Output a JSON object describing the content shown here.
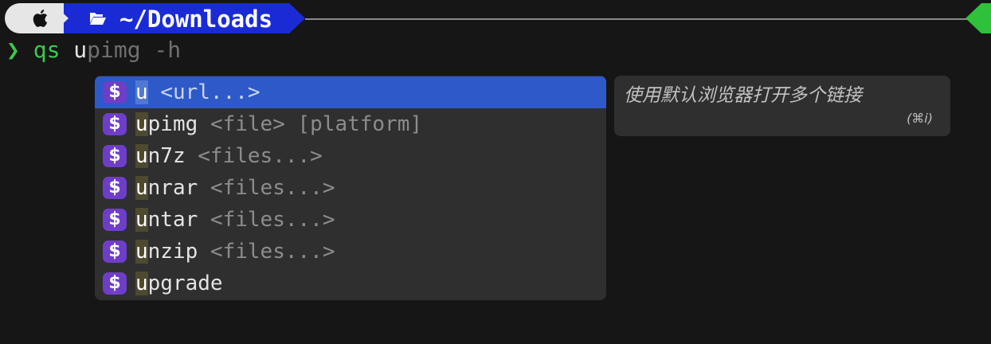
{
  "prompt": {
    "directory": "~/Downloads",
    "apple_icon": "apple-logo-icon",
    "folder_icon": "folder-open-icon",
    "colors": {
      "apple_segment": "#e6e6e6",
      "dir_segment": "#1a2bd6",
      "right_cap": "#2fc03c"
    }
  },
  "command": {
    "chevron": "❯",
    "name": "qs",
    "typed": "u",
    "suggestion": "pimg -h"
  },
  "completions": {
    "items": [
      {
        "match": "u",
        "rest": "",
        "args": "<url...>",
        "selected": true
      },
      {
        "match": "u",
        "rest": "pimg",
        "args": "<file> [platform]",
        "selected": false
      },
      {
        "match": "u",
        "rest": "n7z",
        "args": "<files...>",
        "selected": false
      },
      {
        "match": "u",
        "rest": "nrar",
        "args": "<files...>",
        "selected": false
      },
      {
        "match": "u",
        "rest": "ntar",
        "args": "<files...>",
        "selected": false
      },
      {
        "match": "u",
        "rest": "nzip",
        "args": "<files...>",
        "selected": false
      },
      {
        "match": "u",
        "rest": "pgrade",
        "args": "",
        "selected": false
      }
    ],
    "item_icon": "$",
    "selected_color": "#2d5ac8",
    "icon_color": "#6e3ec8"
  },
  "description": {
    "text": "使用默认浏览器打开多个链接",
    "shortcut": "(⌘i)"
  }
}
